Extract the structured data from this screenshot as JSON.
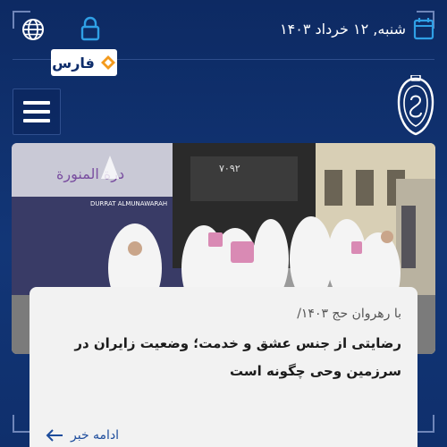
{
  "header": {
    "date": "شنبه, ۱۲ خرداد ۱۴۰۳",
    "logo_text": "فارس",
    "icons": {
      "language": "globe-icon",
      "login": "lock-icon",
      "date": "calendar-icon",
      "menu": "hamburger-menu-icon",
      "emblem": "emblem-icon"
    }
  },
  "colors": {
    "background": "#0f2f6c",
    "accent": "#2fa0e6",
    "logo_orange": "#f39a1d",
    "link": "#1d4c9c"
  },
  "news_card": {
    "category": "با رهروان حج ۱۴۰۳/",
    "title": "رضایتی از جنس عشق و خدمت؛ وضعیت زایران در سرزمین وحی چگونه است",
    "read_more": "ادامه خبر",
    "image_texts": {
      "bus_name_ar": "درة المنورة",
      "bus_name_en": "DURRAT ALMUNAWARAH",
      "bus_number": "۷۰۹۲"
    }
  }
}
